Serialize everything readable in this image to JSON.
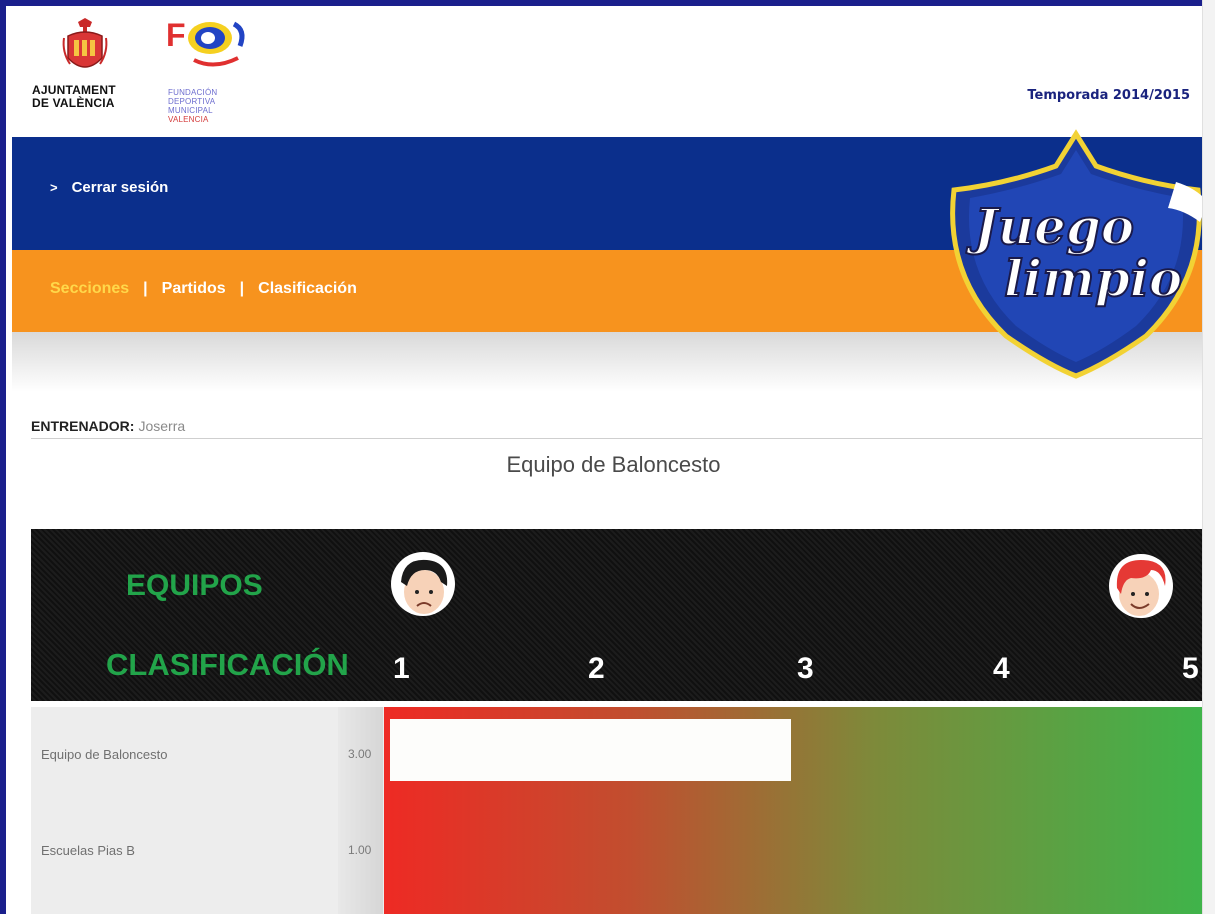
{
  "header": {
    "ajuntament_line1": "AJUNTAMENT",
    "ajuntament_line2": "DE VALÈNCIA",
    "fdm_line1": "FUNDACIÓN",
    "fdm_line2": "DEPORTIVA",
    "fdm_line3": "MUNICIPAL",
    "fdm_line4": "VALENCIA",
    "season": "Temporada 2014/2015"
  },
  "session": {
    "logout_label": "Cerrar sesión",
    "chevron": ">"
  },
  "nav": {
    "items": [
      "Secciones",
      "Partidos",
      "Clasificación"
    ],
    "active": "Secciones",
    "separator": "|"
  },
  "badge": {
    "line1": "Juego",
    "line2": "limpio"
  },
  "coach": {
    "label": "ENTRENADOR:",
    "name": "Joserra"
  },
  "team_title": "Equipo de Baloncesto",
  "board": {
    "equipos_label": "EQUIPOS",
    "clasificacion_label": "CLASIFICACIÓN",
    "scale": [
      "1",
      "2",
      "3",
      "4",
      "5"
    ],
    "left_face_icon": "sad-face-icon",
    "right_face_icon": "happy-face-icon"
  },
  "ranking": {
    "rows": [
      {
        "team": "Equipo de Baloncesto",
        "score": "3.00",
        "value": 3.0
      },
      {
        "team": "Escuelas Pias B",
        "score": "1.00",
        "value": 1.0
      }
    ],
    "scale_min": 1,
    "scale_max": 5
  },
  "colors": {
    "blue_bar": "#0b2f8c",
    "orange_bar": "#f7931e",
    "active_nav": "#ffd84a",
    "green_label": "#22a44a",
    "gradient_start": "#ee2a24",
    "gradient_end": "#3fb44a"
  }
}
